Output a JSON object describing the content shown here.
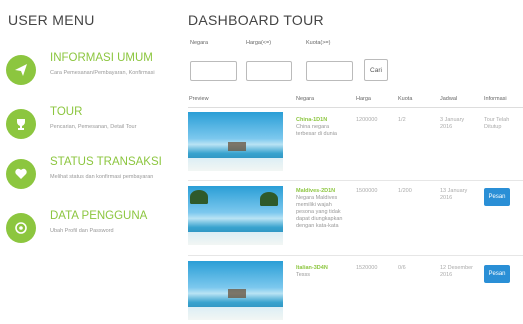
{
  "sidebar": {
    "title": "USER MENU",
    "items": [
      {
        "label": "INFORMASI UMUM",
        "desc": "Cara Pemesanan/Pembayaran, Konfirmasi",
        "icon": "send-icon"
      },
      {
        "label": "TOUR",
        "desc": "Pencarian, Pemesanan, Detail Tour",
        "icon": "trophy-icon"
      },
      {
        "label": "STATUS TRANSAKSI",
        "desc": "Melihat status dan konfirmasi pembayaran",
        "icon": "heart-icon"
      },
      {
        "label": "DATA PENGGUNA",
        "desc": "Ubah Profil dan Password",
        "icon": "user-icon"
      }
    ]
  },
  "main": {
    "title": "DASHBOARD TOUR",
    "filters": {
      "negara_label": "Negara",
      "harga_label": "Harga(<=)",
      "kuota_label": "Kuota(>=)",
      "negara_value": "",
      "harga_value": "",
      "kuota_value": "",
      "search_label": "Cari"
    },
    "table": {
      "headers": [
        "Preview",
        "Negara",
        "Harga",
        "Kuota",
        "Jadwal",
        "Informasi"
      ],
      "rows": [
        {
          "negara_name": "China-1D1N",
          "negara_desc": [
            "China negara",
            "terbesar di dunia"
          ],
          "harga": "1200000",
          "kuota": "1/2",
          "jadwal": [
            "3 January",
            "2016"
          ],
          "informasi": [
            "Tour Telah",
            "Ditutup"
          ],
          "action": null
        },
        {
          "negara_name": "Maldives-2D1N",
          "negara_desc": [
            "Negara Maldives",
            "memiliki wajah",
            "pesona yang tidak",
            "dapat diungkapkan",
            "dengan kata-kata"
          ],
          "harga": "1500000",
          "kuota": "1/200",
          "jadwal": [
            "13 January",
            "2016"
          ],
          "informasi": [],
          "action": "Pesan"
        },
        {
          "negara_name": "Italian-3D4N",
          "negara_desc": [
            "Tesss"
          ],
          "harga": "1520000",
          "kuota": "0/6",
          "jadwal": [
            "12 Desember",
            "2016"
          ],
          "informasi": [],
          "action": "Pesan"
        }
      ]
    }
  },
  "colors": {
    "accent_green": "#8cc63f",
    "button_blue": "#2a8fd6"
  }
}
